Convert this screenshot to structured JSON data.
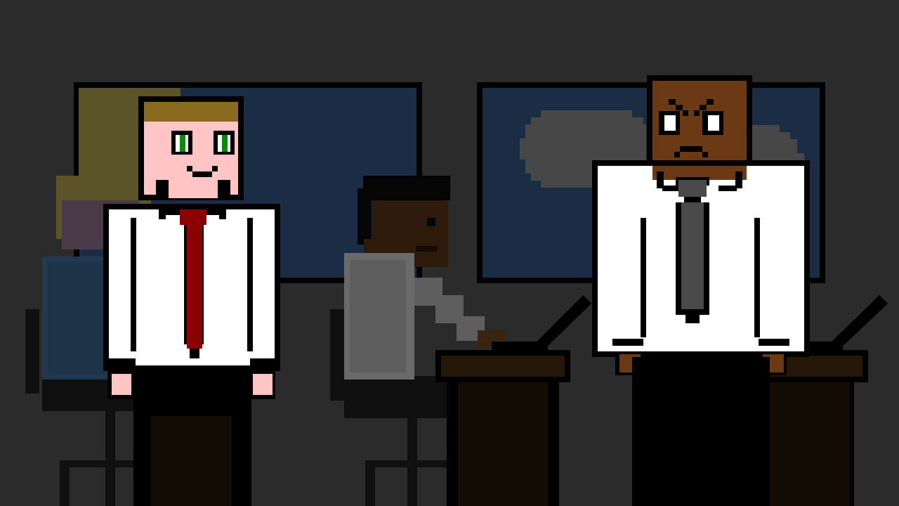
{
  "scene": {
    "type": "pixel-art office cutscene",
    "colors": {
      "background": "#2b2b2b",
      "window_frame": "#000000",
      "window_glass": "#1b2d45",
      "cloud": "#474747",
      "desk": "#130c04",
      "desk_top": "#24170a",
      "shirt_white": "#ffffff",
      "tie_red": "#8b0000",
      "tie_grey": "#4a4a4a",
      "skin_light": "#ffc4c4",
      "skin_brown": "#6b3a12",
      "skin_dark": "#2e1a0a",
      "hair_blonde": "#8a6a1e",
      "eyes_green": "#0a8a0a"
    },
    "characters": [
      {
        "name": "blonde-coworker-background",
        "mood": "neutral",
        "tie": "red"
      },
      {
        "name": "seated-coworker-typing",
        "mood": "focused",
        "shirt": "grey"
      },
      {
        "name": "angry-boss",
        "mood": "angry",
        "tie": "grey"
      },
      {
        "name": "smiling-employee",
        "mood": "happy",
        "tie": "red"
      }
    ],
    "objects": [
      "window-left",
      "window-right",
      "desk-center",
      "desk-right",
      "office-chair-left",
      "office-chair-center",
      "office-chair-right",
      "laptop-center",
      "laptop-right"
    ]
  }
}
